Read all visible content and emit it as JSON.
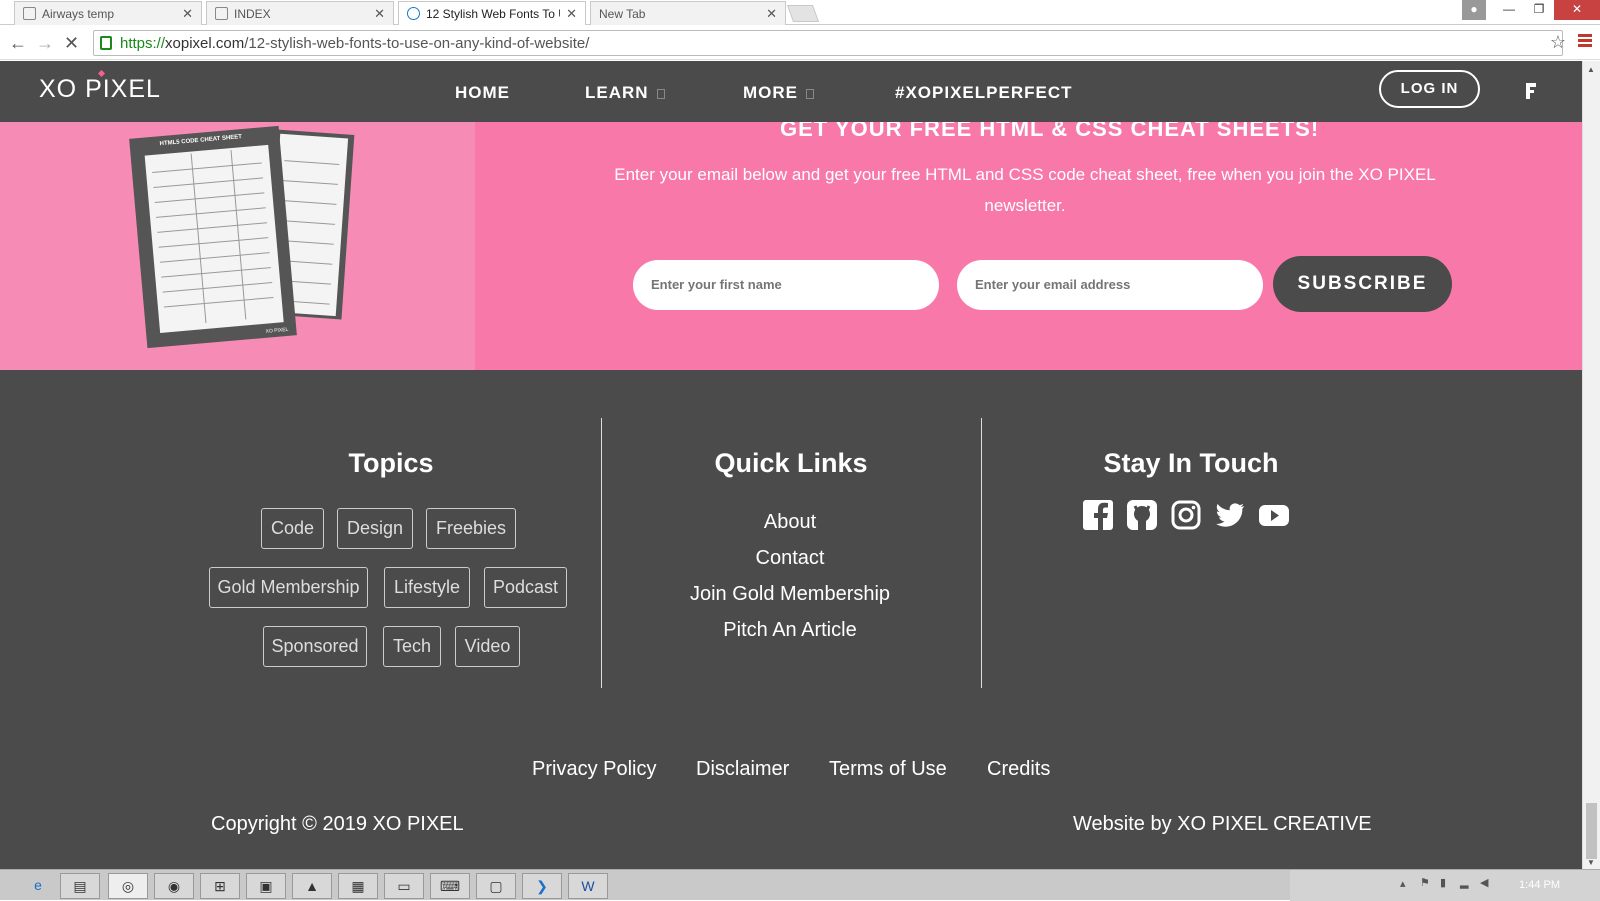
{
  "browser": {
    "tabs": [
      {
        "title": "Airways temp"
      },
      {
        "title": "INDEX"
      },
      {
        "title": "12 Stylish Web Fonts To U"
      },
      {
        "title": "New Tab"
      }
    ],
    "url_https": "https://",
    "url_host": "xopixel.com",
    "url_path": "/12-stylish-web-fonts-to-use-on-any-kind-of-website/"
  },
  "nav": {
    "logo": "XO PIXEL",
    "items": [
      "HOME",
      "LEARN",
      "MORE",
      "#XOPIXELPERFECT"
    ],
    "login": "LOG IN"
  },
  "cta": {
    "title": "GET YOUR FREE HTML & CSS CHEAT SHEETS!",
    "text": "Enter your email below and get your free HTML and CSS code cheat sheet, free when you join the XO PIXEL newsletter.",
    "first_name_placeholder": "Enter your first name",
    "email_placeholder": "Enter your email address",
    "subscribe": "SUBSCRIBE",
    "sheet_title": "HTML5 CODE CHEAT SHEET",
    "sheet_brand": "XO PIXEL"
  },
  "footer": {
    "topics_title": "Topics",
    "topics": [
      "Code",
      "Design",
      "Freebies",
      "Gold Membership",
      "Lifestyle",
      "Podcast",
      "Sponsored",
      "Tech",
      "Video"
    ],
    "quick_title": "Quick Links",
    "quick_links": [
      "About",
      "Contact",
      "Join Gold Membership",
      "Pitch An Article"
    ],
    "stay_title": "Stay In Touch",
    "social": [
      "facebook-icon",
      "github-icon",
      "instagram-icon",
      "twitter-icon",
      "youtube-icon"
    ],
    "legal": [
      "Privacy Policy",
      "Disclaimer",
      "Terms of Use",
      "Credits"
    ],
    "copyright": "Copyright © 2019 XO PIXEL",
    "credit": "Website by XO PIXEL CREATIVE"
  },
  "taskbar": {
    "time": "1:44 PM"
  },
  "colors": {
    "pink": "#f878a9",
    "pink_light": "#f68cb5",
    "dark": "#4b4b4b"
  }
}
